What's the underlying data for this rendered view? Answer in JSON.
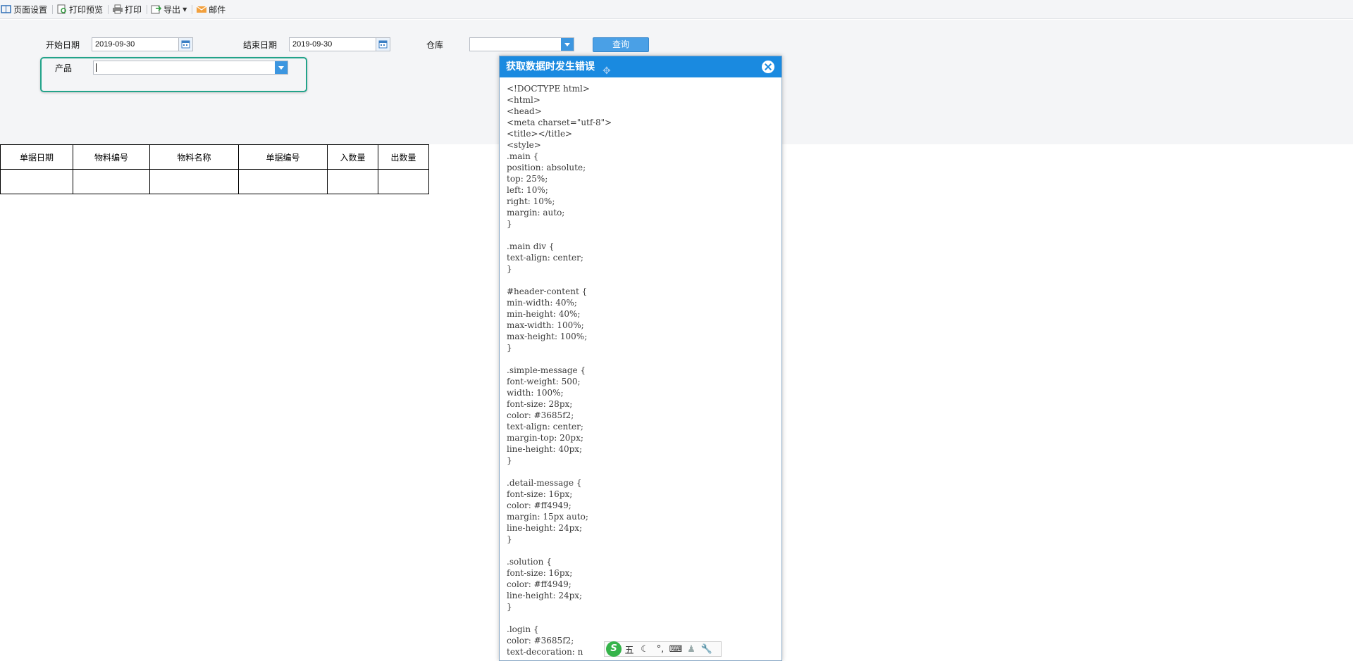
{
  "toolbar": {
    "page_setup": "页面设置",
    "print_preview": "打印预览",
    "print": "打印",
    "export": "导出",
    "mail": "邮件"
  },
  "filters": {
    "start_date_label": "开始日期",
    "start_date_value": "2019-09-30",
    "end_date_label": "结束日期",
    "end_date_value": "2019-09-30",
    "warehouse_label": "仓库",
    "warehouse_value": "",
    "product_label": "产品",
    "product_value": "",
    "query_button": "查询"
  },
  "table": {
    "columns": [
      "单据日期",
      "物料编号",
      "物料名称",
      "单据编号",
      "入数量",
      "出数量"
    ],
    "rows": [
      [
        "",
        "",
        "",
        "",
        "",
        ""
      ]
    ]
  },
  "dialog": {
    "title": "获取数据时发生错误",
    "content": "<!DOCTYPE html>\n<html>\n<head>\n<meta charset=\"utf-8\">\n<title></title>\n<style>\n.main {\nposition: absolute;\ntop: 25%;\nleft: 10%;\nright: 10%;\nmargin: auto;\n}\n\n.main div {\ntext-align: center;\n}\n\n#header-content {\nmin-width: 40%;\nmin-height: 40%;\nmax-width: 100%;\nmax-height: 100%;\n}\n\n.simple-message {\nfont-weight: 500;\nwidth: 100%;\nfont-size: 28px;\ncolor: #3685f2;\ntext-align: center;\nmargin-top: 20px;\nline-height: 40px;\n}\n\n.detail-message {\nfont-size: 16px;\ncolor: #ff4949;\nmargin: 15px auto;\nline-height: 24px;\n}\n\n.solution {\nfont-size: 16px;\ncolor: #ff4949;\nline-height: 24px;\n}\n\n.login {\ncolor: #3685f2;\ntext-decoration: n"
  },
  "ime": {
    "logo": "S",
    "mode": "五",
    "items": [
      "moon-icon",
      "punctuation-icon",
      "keyboard-icon",
      "user-icon",
      "wrench-icon"
    ]
  },
  "colors": {
    "toolbar_bg": "#f4f5f7",
    "dialog_title_bg": "#1a8ae0",
    "query_button_bg": "#4aa0e6",
    "highlight_border": "#22a38a"
  }
}
